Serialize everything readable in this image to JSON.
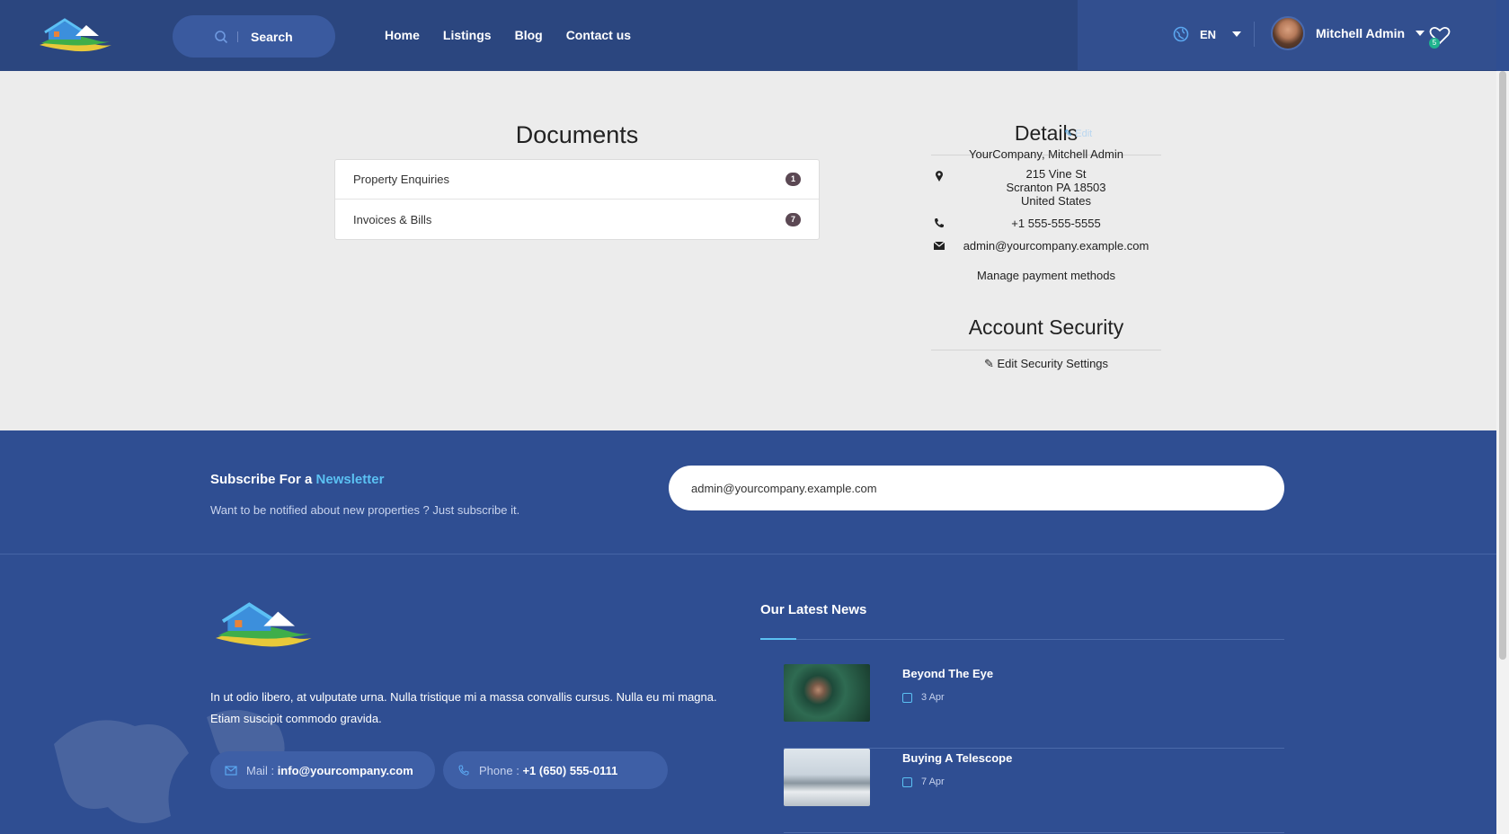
{
  "header": {
    "search_label": "Search",
    "nav": [
      "Home",
      "Listings",
      "Blog",
      "Contact us"
    ],
    "language": "EN",
    "user_name": "Mitchell Admin",
    "wishlist_count": "5"
  },
  "documents": {
    "title": "Documents",
    "items": [
      {
        "label": "Property Enquiries",
        "count": "1"
      },
      {
        "label": "Invoices & Bills",
        "count": "7"
      }
    ]
  },
  "details": {
    "title": "Details",
    "edit_label": "Edit",
    "company": "YourCompany, Mitchell Admin",
    "address_line1": "215 Vine St",
    "address_line2": "Scranton PA 18503",
    "address_line3": "United States",
    "phone": "+1 555-555-5555",
    "email": "admin@yourcompany.example.com",
    "payment_link": "Manage payment methods"
  },
  "security": {
    "title": "Account Security",
    "edit_link": "Edit Security Settings"
  },
  "newsletter": {
    "title_prefix": "Subscribe For a",
    "title_highlight": "Newsletter",
    "subtitle": "Want to be notified about new properties ? Just subscribe it.",
    "email_value": "admin@yourcompany.example.com"
  },
  "footer": {
    "description": "In ut odio libero, at vulputate urna. Nulla tristique mi a massa convallis cursus. Nulla eu mi magna. Etiam suscipit commodo gravida.",
    "mail_label": "Mail :",
    "mail_value": "info@yourcompany.com",
    "phone_label": "Phone :",
    "phone_value": "+1 (650) 555-0111",
    "news_title": "Our Latest News",
    "news": [
      {
        "title": "Beyond The Eye",
        "date": "3 Apr"
      },
      {
        "title": "Buying A Telescope",
        "date": "7 Apr"
      }
    ]
  },
  "colors": {
    "header_bg": "#2b467f",
    "footer_bg": "#2f4e92",
    "accent": "#5bc1f3",
    "badge": "#5b4853"
  }
}
